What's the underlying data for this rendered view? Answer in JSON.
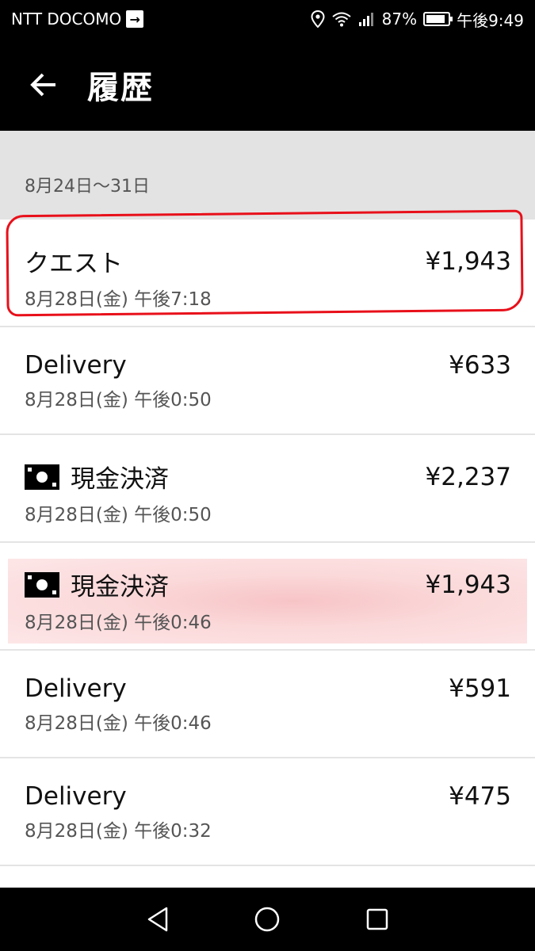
{
  "status_bar": {
    "carrier": "NTT DOCOMO",
    "battery": "87%",
    "time": "午後9:49"
  },
  "app_bar": {
    "title": "履歴"
  },
  "week": {
    "label": "8月24日〜31日"
  },
  "trips": [
    {
      "title": "クエスト",
      "amount": "¥1,943",
      "date": "8月28日(金) 午後7:18",
      "cash": false
    },
    {
      "title": "Delivery",
      "amount": "¥633",
      "date": "8月28日(金) 午後0:50",
      "cash": false
    },
    {
      "title": "現金決済",
      "amount": "¥2,237",
      "date": "8月28日(金) 午後0:50",
      "cash": true
    },
    {
      "title": "現金決済",
      "amount": "¥1,943",
      "date": "8月28日(金) 午後0:46",
      "cash": true
    },
    {
      "title": "Delivery",
      "amount": "¥591",
      "date": "8月28日(金) 午後0:46",
      "cash": false
    },
    {
      "title": "Delivery",
      "amount": "¥475",
      "date": "8月28日(金) 午後0:32",
      "cash": false
    }
  ],
  "colors": {
    "annotation_outline": "#e8101a",
    "highlight_band": "#f7c4c6"
  },
  "icons": {
    "back": "arrow-left-icon",
    "cash": "cash-icon",
    "nav_back": "triangle-back-icon",
    "nav_home": "circle-home-icon",
    "nav_recents": "square-recents-icon"
  }
}
